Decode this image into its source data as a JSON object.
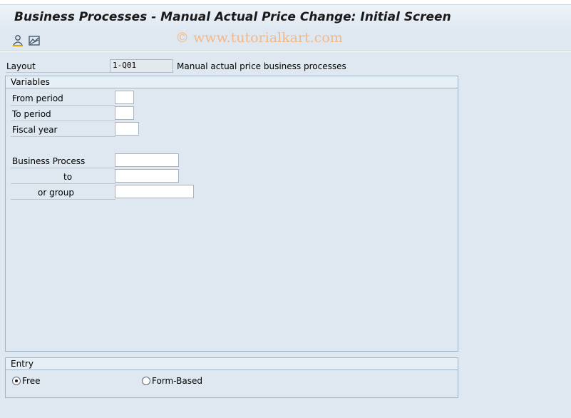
{
  "window": {
    "title": "Business Processes - Manual Actual Price Change: Initial Screen"
  },
  "toolbar": {
    "icons": [
      "user-settings-icon",
      "chart-icon"
    ]
  },
  "watermark": "© www.tutorialkart.com",
  "layout": {
    "label": "Layout",
    "value": "1-Q01",
    "description": "Manual actual price business processes"
  },
  "variables": {
    "header": "Variables",
    "from_period": {
      "label": "From period",
      "value": ""
    },
    "to_period": {
      "label": "To period",
      "value": ""
    },
    "fiscal_year": {
      "label": "Fiscal year",
      "value": ""
    },
    "business_process": {
      "label": "Business Process",
      "value": ""
    },
    "bp_to": {
      "label": "to",
      "value": ""
    },
    "bp_group": {
      "label": "or group",
      "value": ""
    }
  },
  "entry": {
    "header": "Entry",
    "options": [
      {
        "label": "Free",
        "selected": true
      },
      {
        "label": "Form-Based",
        "selected": false
      }
    ]
  }
}
